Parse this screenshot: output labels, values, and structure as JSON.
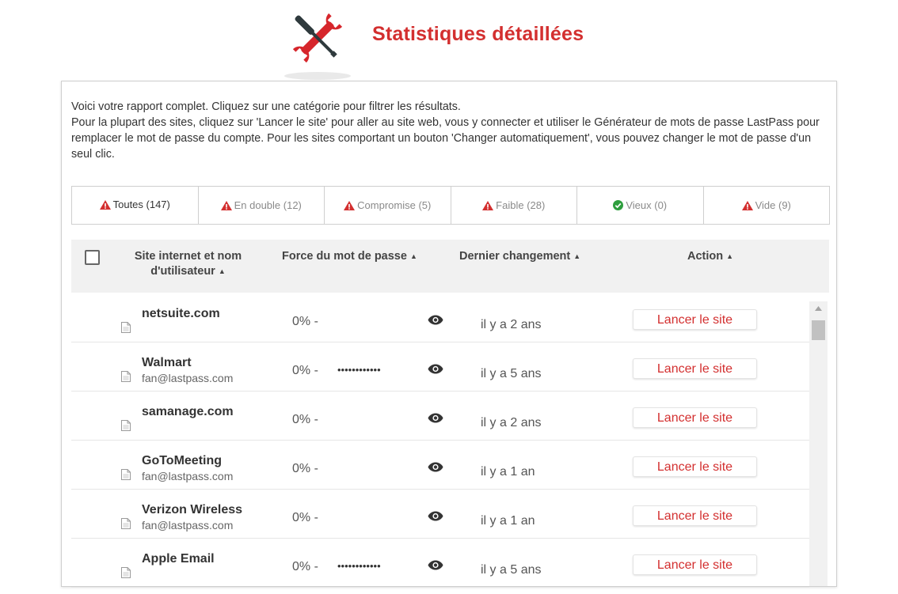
{
  "header": {
    "title": "Statistiques détaillées",
    "logo_icon": "tools-icon"
  },
  "intro": {
    "line1": "Voici votre rapport complet. Cliquez sur une catégorie pour filtrer les résultats.",
    "line2": "Pour la plupart des sites, cliquez sur 'Lancer le site' pour aller au site web, vous y connecter et utiliser le Générateur de mots de passe LastPass pour remplacer le mot de passe du compte. Pour les sites comportant un bouton 'Changer automatiquement', vous pouvez changer le mot de passe d'un seul clic."
  },
  "tabs": [
    {
      "label": "Toutes (147)",
      "icon": "warning-icon",
      "active": true
    },
    {
      "label": "En double (12)",
      "icon": "warning-icon",
      "active": false
    },
    {
      "label": "Compromise (5)",
      "icon": "warning-icon",
      "active": false
    },
    {
      "label": "Faible (28)",
      "icon": "warning-icon",
      "active": false
    },
    {
      "label": "Vieux (0)",
      "icon": "check-circle-icon",
      "active": false
    },
    {
      "label": "Vide (9)",
      "icon": "warning-icon",
      "active": false
    }
  ],
  "table": {
    "columns": {
      "site_line1": "Site internet et nom",
      "site_line2": "d'utilisateur",
      "strength": "Force du mot de passe",
      "changed": "Dernier changement",
      "action": "Action"
    },
    "sort_caret": "▲",
    "rows": [
      {
        "site": "netsuite.com",
        "user": "",
        "strength": "0% -",
        "password": "",
        "changed": "il y a 2 ans",
        "action": "Lancer le site"
      },
      {
        "site": "Walmart",
        "user": "fan@lastpass.com",
        "strength": "0% -",
        "password": "••••••••••••",
        "changed": "il y a 5 ans",
        "action": "Lancer le site"
      },
      {
        "site": "samanage.com",
        "user": "",
        "strength": "0% -",
        "password": "",
        "changed": "il y a 2 ans",
        "action": "Lancer le site"
      },
      {
        "site": "GoToMeeting",
        "user": "fan@lastpass.com",
        "strength": "0% -",
        "password": "",
        "changed": "il y a 1 an",
        "action": "Lancer le site"
      },
      {
        "site": "Verizon Wireless",
        "user": "fan@lastpass.com",
        "strength": "0% -",
        "password": "",
        "changed": "il y a 1 an",
        "action": "Lancer le site"
      },
      {
        "site": "Apple Email",
        "user": "",
        "strength": "0% -",
        "password": "••••••••••••",
        "changed": "il y a 5 ans",
        "action": "Lancer le site"
      }
    ]
  },
  "colors": {
    "accent": "#d32f2f",
    "header_bg": "#f1f1f1",
    "check_green": "#2e9e3e"
  }
}
